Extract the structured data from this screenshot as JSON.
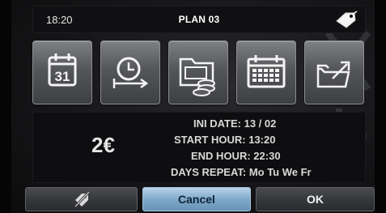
{
  "topbar": {
    "time": "18:20",
    "title": "PLAN 03"
  },
  "toolbar": {
    "buttons": [
      {
        "name": "calendar-day-button",
        "icon": "calendar-31-icon",
        "label": "31"
      },
      {
        "name": "timer-button",
        "icon": "clock-arrow-icon"
      },
      {
        "name": "money-folder-button",
        "icon": "folder-coins-icon"
      },
      {
        "name": "calendar-grid-button",
        "icon": "calendar-grid-icon"
      },
      {
        "name": "export-button",
        "icon": "folder-export-icon"
      }
    ]
  },
  "info": {
    "price": "2€",
    "ini_date_label": "INI DATE:",
    "ini_date": "13 / 02",
    "start_hour_label": "START HOUR:",
    "start_hour": "13:20",
    "end_hour_label": "END HOUR:",
    "end_hour": "22:30",
    "days_repeat_label": "DAYS REPEAT:",
    "days_repeat": "Mo Tu We Fr"
  },
  "footer": {
    "cancel_label": "Cancel",
    "ok_label": "OK"
  },
  "colors": {
    "accent": "#7ea8c8",
    "button_gray": "#54565a"
  }
}
